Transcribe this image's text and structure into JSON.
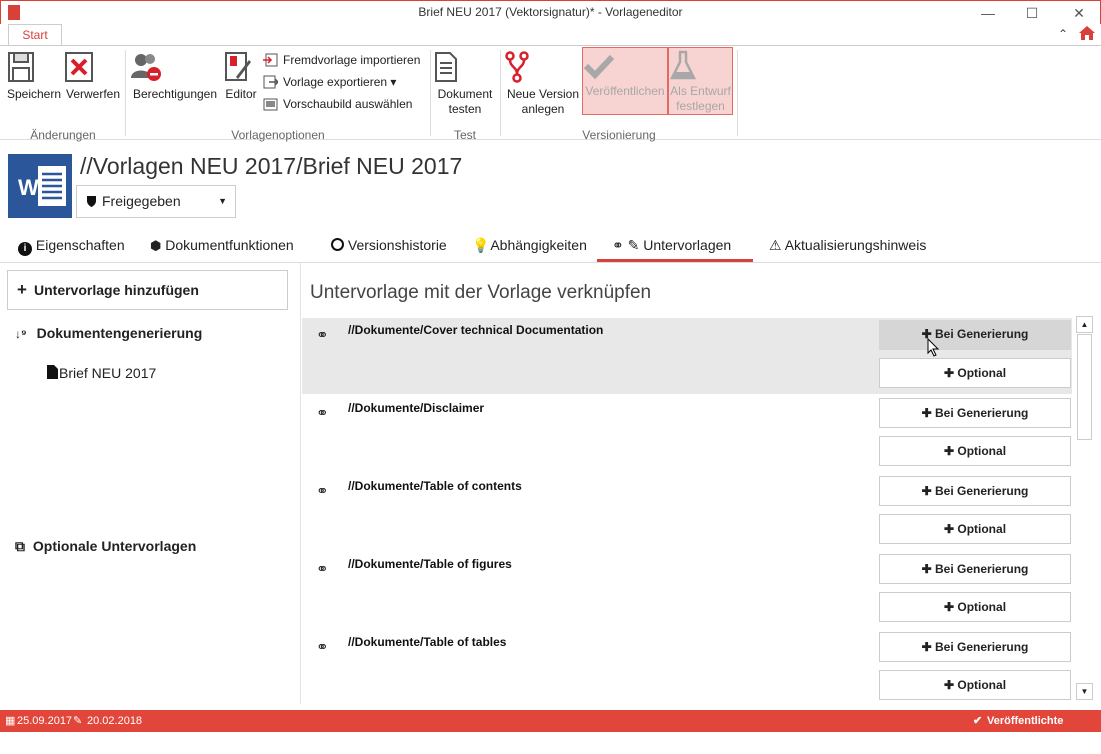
{
  "window": {
    "title": "Brief NEU 2017 (Vektorsignatur)* - Vorlageneditor",
    "minimize": "—",
    "maximize": "☐",
    "close": "✕"
  },
  "ribbon": {
    "tab": "Start",
    "speichern": "Speichern",
    "verwerfen": "Verwerfen",
    "group_aenderungen": "Änderungen",
    "berechtigungen": "Berechtigungen",
    "editor": "Editor",
    "fremdvorlage": "Fremdvorlage importieren",
    "vorlage_exportieren": "Vorlage exportieren ▾",
    "vorschaubild": "Vorschaubild auswählen",
    "group_vorlagenoptionen": "Vorlagenoptionen",
    "dokument_testen_1": "Dokument",
    "dokument_testen_2": "testen",
    "group_test": "Test",
    "neue_version_1": "Neue Version",
    "neue_version_2": "anlegen",
    "veroeffentlichen": "Veröffentlichen",
    "als_entwurf_1": "Als Entwurf",
    "als_entwurf_2": "festlegen",
    "group_versionierung": "Versionierung"
  },
  "header": {
    "title": "//Vorlagen NEU 2017/Brief NEU 2017",
    "status": "Freigegeben"
  },
  "tabs": [
    {
      "label": "Eigenschaften"
    },
    {
      "label": "Dokumentfunktionen"
    },
    {
      "label": "Versionshistorie"
    },
    {
      "label": "Abhängigkeiten"
    },
    {
      "label": "Untervorlagen"
    },
    {
      "label": "Aktualisierungshinweis"
    }
  ],
  "left": {
    "add_button": "Untervorlage hinzufügen",
    "section_generation": "Dokumentengenerierung",
    "item_brief": "Brief NEU 2017",
    "section_optional": "Optionale Untervorlagen"
  },
  "right": {
    "title": "Untervorlage mit der Vorlage verknüpfen",
    "btn_generation": "Bei Generierung",
    "btn_optional": "Optional",
    "rows": [
      {
        "path": "//Dokumente/Cover technical Documentation"
      },
      {
        "path": "//Dokumente/Disclaimer"
      },
      {
        "path": "//Dokumente/Table of contents"
      },
      {
        "path": "//Dokumente/Table of figures"
      },
      {
        "path": "//Dokumente/Table of tables"
      }
    ]
  },
  "status": {
    "date_created": "25.09.2017",
    "date_modified": "20.02.2018",
    "version_state": "Veröffentlichte Version"
  },
  "colors": {
    "accent": "#e2463a",
    "word_blue": "#2b579a"
  }
}
